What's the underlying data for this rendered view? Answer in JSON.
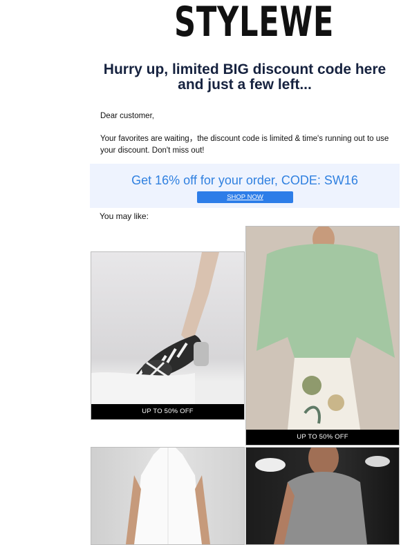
{
  "brand": {
    "logo_text": "STYLEWE"
  },
  "headline": "Hurry up, limited BIG discount code here and just a few left...",
  "greeting": "Dear customer,",
  "body_text": "Your favorites are waiting，the discount code is limited & time's running out to use your discount. Don't miss out!",
  "promo": {
    "text": "Get 16% off for your order, CODE: SW16",
    "button_label": "SHOP NOW",
    "accent": "#2f80e0",
    "background": "#eef3fe"
  },
  "recommendations": {
    "heading": "You may like:",
    "products": [
      {
        "image": "striped-bow-heel-shoe",
        "badge": "UP TO 50% OFF"
      },
      {
        "image": "green-cape-top-floral-skirt",
        "badge": "UP TO 50% OFF"
      },
      {
        "image": "white-sleeveless-dress",
        "badge": ""
      },
      {
        "image": "gray-halter-top",
        "badge": ""
      }
    ]
  }
}
